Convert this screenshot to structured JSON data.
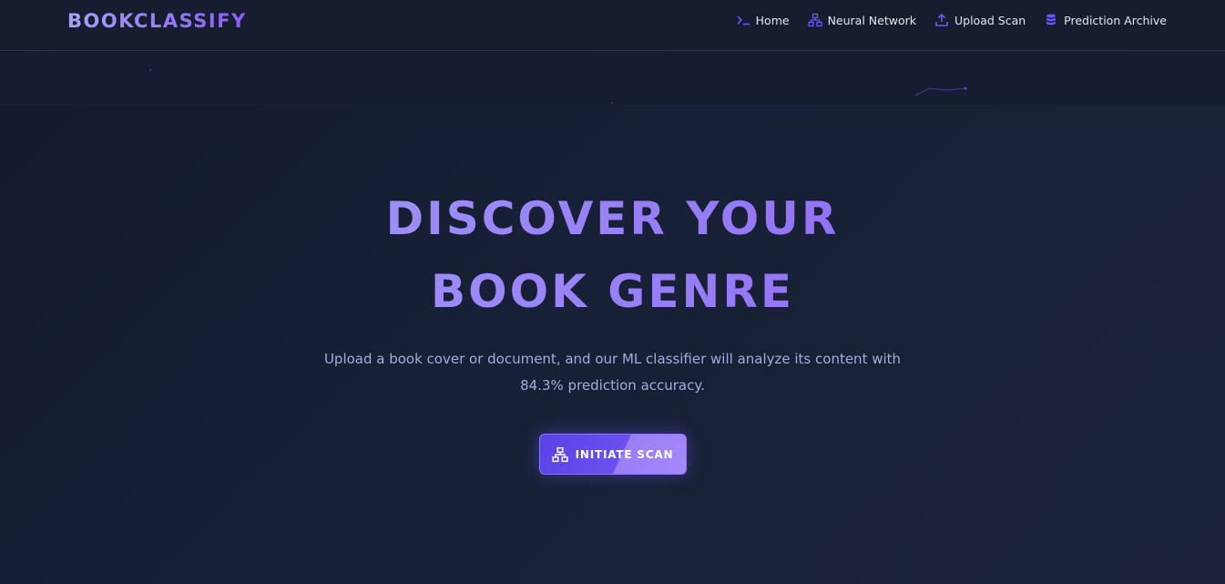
{
  "brand": {
    "name": "BOOKCLASSIFY"
  },
  "nav": {
    "items": [
      {
        "label": "Home",
        "icon": "terminal-icon"
      },
      {
        "label": "Neural Network",
        "icon": "network-icon"
      },
      {
        "label": "Upload Scan",
        "icon": "upload-icon"
      },
      {
        "label": "Prediction Archive",
        "icon": "database-icon"
      }
    ]
  },
  "hero": {
    "title_line1": "DISCOVER YOUR",
    "title_line2": "BOOK GENRE",
    "subtitle_line1": "Upload a book cover or document, and our ML classifier will analyze its content with",
    "subtitle_line2": "84.3% prediction accuracy.",
    "cta_label": "INITIATE SCAN",
    "cta_icon": "network-icon"
  },
  "colors": {
    "background": "#151b2e",
    "accent": "#6d56f6",
    "accent_light": "#a5a2f5",
    "text": "#e2e6f0",
    "subtext": "#a4acd9"
  }
}
